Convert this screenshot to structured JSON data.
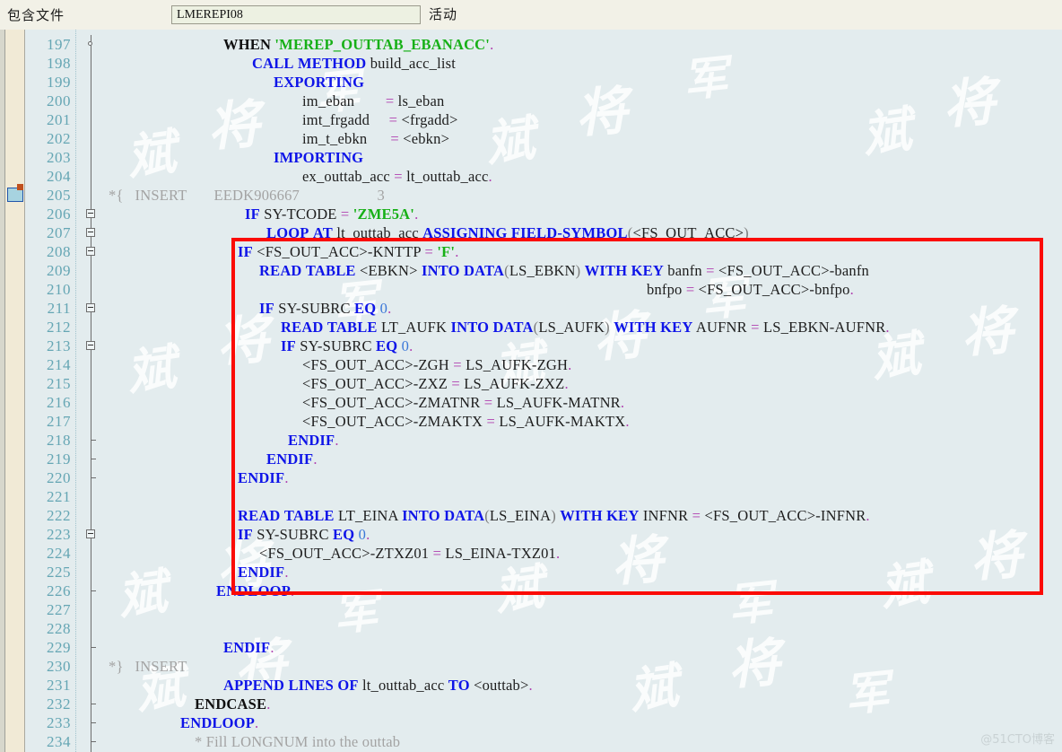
{
  "header": {
    "label": "包含文件",
    "include_name": "LMEREPI08",
    "status": "活动"
  },
  "editor": {
    "first_line": 197,
    "last_line": 234,
    "bookmark_line": 205,
    "annotation_note": "red-rectangle-highlight",
    "colors": {
      "background": "#e3ecee",
      "gutter": "#f1ead6",
      "linenumber": "#65a6b4",
      "keyword": "#0e14e8",
      "literal": "#17b017",
      "operator": "#b040b0",
      "number": "#3b78d8",
      "comment": "#a3a3a3",
      "annotation": "#fb0b05"
    },
    "lines": [
      {
        "n": 197,
        "text": "WHEN 'MEREP_OUTTAB_EBANACC'."
      },
      {
        "n": 198,
        "text": "CALL METHOD build_acc_list"
      },
      {
        "n": 199,
        "text": "EXPORTING"
      },
      {
        "n": 200,
        "text": "im_eban        = ls_eban"
      },
      {
        "n": 201,
        "text": "imt_frgadd     = <frgadd>"
      },
      {
        "n": 202,
        "text": "im_t_ebkn      = <ebkn>"
      },
      {
        "n": 203,
        "text": "IMPORTING"
      },
      {
        "n": 204,
        "text": "ex_outtab_acc = lt_outtab_acc."
      },
      {
        "n": 205,
        "text": "*{   INSERT       EEDK906667                    3"
      },
      {
        "n": 206,
        "text": "IF SY-TCODE = 'ZME5A'."
      },
      {
        "n": 207,
        "text": "LOOP AT lt_outtab_acc ASSIGNING FIELD-SYMBOL(<FS_OUT_ACC>)"
      },
      {
        "n": 208,
        "text": "IF <FS_OUT_ACC>-KNTTP = 'F'."
      },
      {
        "n": 209,
        "text": "READ TABLE <EBKN> INTO DATA(LS_EBKN) WITH KEY banfn = <FS_OUT_ACC>-banfn"
      },
      {
        "n": 210,
        "text": "bnfpo = <FS_OUT_ACC>-bnfpo."
      },
      {
        "n": 211,
        "text": "IF SY-SUBRC EQ 0."
      },
      {
        "n": 212,
        "text": "READ TABLE LT_AUFK INTO DATA(LS_AUFK) WITH KEY AUFNR = LS_EBKN-AUFNR."
      },
      {
        "n": 213,
        "text": "IF SY-SUBRC EQ 0."
      },
      {
        "n": 214,
        "text": "<FS_OUT_ACC>-ZGH = LS_AUFK-ZGH."
      },
      {
        "n": 215,
        "text": "<FS_OUT_ACC>-ZXZ = LS_AUFK-ZXZ."
      },
      {
        "n": 216,
        "text": "<FS_OUT_ACC>-ZMATNR = LS_AUFK-MATNR."
      },
      {
        "n": 217,
        "text": "<FS_OUT_ACC>-ZMAKTX = LS_AUFK-MAKTX."
      },
      {
        "n": 218,
        "text": "ENDIF."
      },
      {
        "n": 219,
        "text": "ENDIF."
      },
      {
        "n": 220,
        "text": "ENDIF."
      },
      {
        "n": 221,
        "text": ""
      },
      {
        "n": 222,
        "text": "READ TABLE LT_EINA INTO DATA(LS_EINA) WITH KEY INFNR = <FS_OUT_ACC>-INFNR."
      },
      {
        "n": 223,
        "text": "IF SY-SUBRC EQ 0."
      },
      {
        "n": 224,
        "text": "<FS_OUT_ACC>-ZTXZ01 = LS_EINA-TXZ01."
      },
      {
        "n": 225,
        "text": "ENDIF."
      },
      {
        "n": 226,
        "text": "ENDLOOP."
      },
      {
        "n": 227,
        "text": ""
      },
      {
        "n": 228,
        "text": ""
      },
      {
        "n": 229,
        "text": "ENDIF."
      },
      {
        "n": 230,
        "text": "*}   INSERT"
      },
      {
        "n": 231,
        "text": "APPEND LINES OF lt_outtab_acc TO <outtab>."
      },
      {
        "n": 232,
        "text": "ENDCASE."
      },
      {
        "n": 233,
        "text": "ENDLOOP."
      },
      {
        "n": 234,
        "text": "* Fill LONGNUM into the outtab"
      }
    ]
  },
  "watermarks": {
    "tiles": [
      "斌",
      "将",
      "军"
    ],
    "corner": "@51CTO博客"
  }
}
